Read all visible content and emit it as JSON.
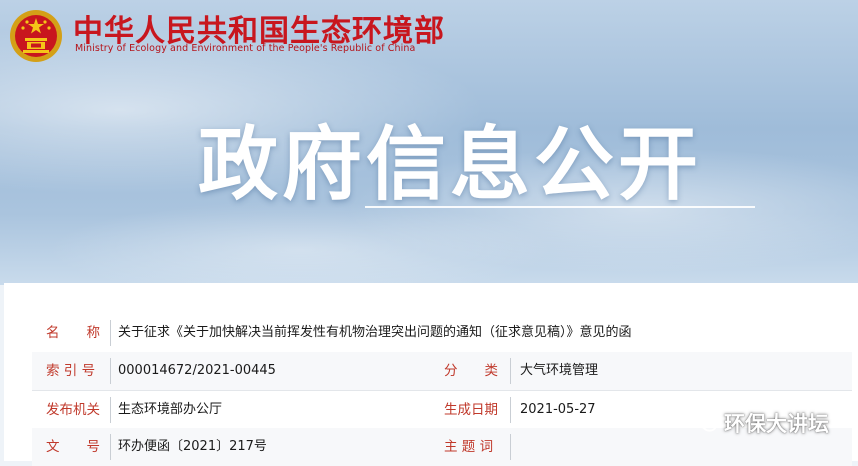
{
  "header": {
    "ministry_name_cn": "中华人民共和国生态环境部",
    "ministry_name_en": "Ministry of Ecology and Environment of the People's Republic of China",
    "emblem_icon": "national-emblem-icon"
  },
  "hero": {
    "title": "政府信息公开"
  },
  "info": {
    "name_label": "名　　称",
    "name_value": "关于征求《关于加快解决当前挥发性有机物治理突出问题的通知（征求意见稿）》意见的函",
    "index_label": "索 引 号",
    "index_value": "000014672/2021-00445",
    "category_label": "分　　类",
    "category_value": "大气环境管理",
    "issuer_label": "发布机关",
    "issuer_value": "生态环境部办公厅",
    "date_label": "生成日期",
    "date_value": "2021-05-27",
    "docno_label": "文　　号",
    "docno_value": "环办便函〔2021〕217号",
    "subject_label": "主 题 词",
    "subject_value": ""
  },
  "watermark": {
    "icon": "wechat-icon",
    "text": "环保大讲坛"
  },
  "colors": {
    "brand_red": "#c8161e",
    "label_red": "#c0392b",
    "sky": "#9fbcd9"
  }
}
